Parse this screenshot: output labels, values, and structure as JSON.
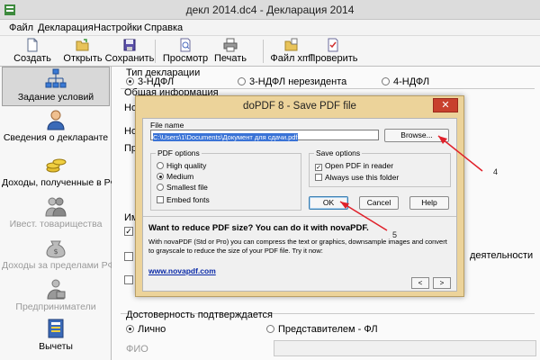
{
  "window": {
    "title": "декл 2014.dc4 - Декларация 2014"
  },
  "menu": [
    "Файл",
    "Декларация",
    "Настройки",
    "Справка"
  ],
  "toolbar": {
    "create": "Создать",
    "open": "Открыть",
    "save": "Сохранить",
    "preview": "Просмотр",
    "print": "Печать",
    "xml": "Файл xml",
    "check": "Проверить"
  },
  "nav": [
    {
      "label": "Задание условий",
      "active": true
    },
    {
      "label": "Сведения о декларанте"
    },
    {
      "label": "Доходы, полученные в РФ"
    },
    {
      "label": "Ивест. товарищества",
      "disabled": true
    },
    {
      "label": "Доходы за пределами РФ",
      "disabled": true
    },
    {
      "label": "Предприниматели",
      "disabled": true
    },
    {
      "label": "Вычеты"
    }
  ],
  "form": {
    "decl_type_label": "Тип декларации",
    "type_3ndfl": "3-НДФЛ",
    "type_3ndfl_nonres": "3-НДФЛ нерезидента",
    "type_4ndfl": "4-НДФЛ",
    "general_info": "Общая информация",
    "partial_no1": "Но",
    "partial_no2": "Но",
    "partial_pr": "Пр",
    "partial_im": "Им",
    "partial_activity": "деятельности",
    "confirm_label": "Достоверность подтверждается",
    "confirm_personal": "Лично",
    "confirm_rep": "Представителем - ФЛ",
    "fio_label": "ФИО"
  },
  "dialog": {
    "title": "doPDF 8 - Save PDF file",
    "close": "✕",
    "file_name_label": "File name",
    "file_path": "C:\\Users\\1\\Documents\\Документ для сдачи.pdf",
    "browse": "Browse...",
    "pdf_options_label": "PDF options",
    "opt_high": "High quality",
    "opt_medium": "Medium",
    "opt_smallest": "Smallest file",
    "opt_embed": "Embed fonts",
    "save_options_label": "Save options",
    "open_reader": "Open PDF in reader",
    "always_folder": "Always use this folder",
    "ok": "OK",
    "cancel": "Cancel",
    "help": "Help",
    "promo_title": "Want to reduce PDF size? You can do it with novaPDF.",
    "promo_text": "With novaPDF (Std or Pro) you can compress the text or graphics, downsample images and convert to grayscale to reduce the size of your PDF file. Try it now:",
    "promo_link": "www.novapdf.com",
    "prev": "<",
    "next": ">"
  },
  "annotations": {
    "step4": "4",
    "step5": "5",
    "arrow_color": "#e0202a"
  }
}
